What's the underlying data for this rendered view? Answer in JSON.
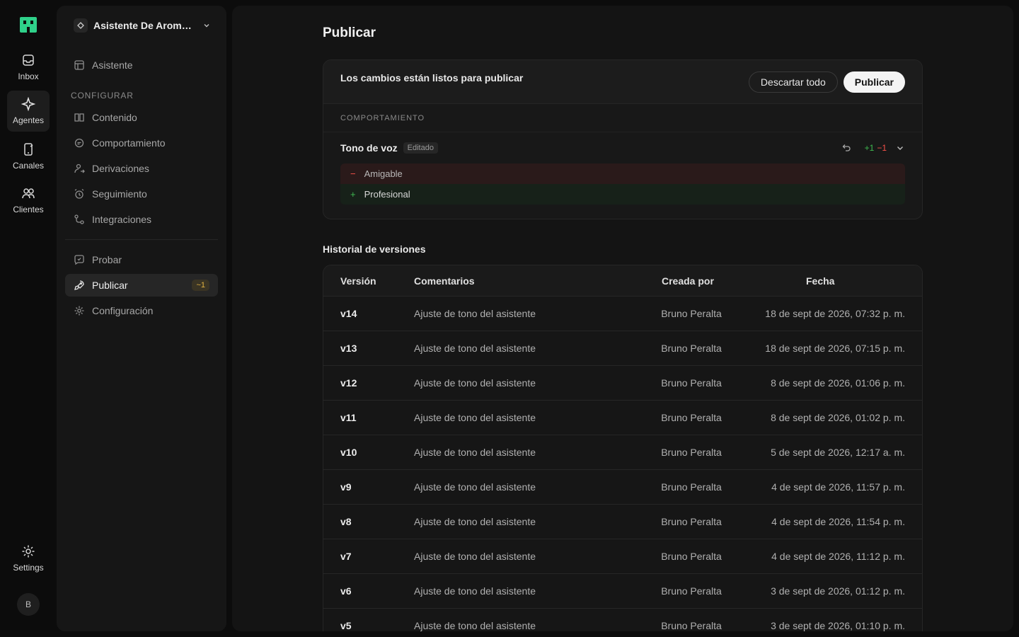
{
  "rail": {
    "items": [
      {
        "label": "Inbox",
        "icon": "inbox-icon"
      },
      {
        "label": "Agentes",
        "icon": "sparkle-icon"
      },
      {
        "label": "Canales",
        "icon": "phone-icon"
      },
      {
        "label": "Clientes",
        "icon": "users-icon"
      }
    ],
    "settings_label": "Settings",
    "avatar_initial": "B"
  },
  "panel": {
    "agent_name": "Asistente De Aromaterapia",
    "top_item": "Asistente",
    "section_label": "CONFIGURAR",
    "config_items": [
      "Contenido",
      "Comportamiento",
      "Derivaciones",
      "Seguimiento",
      "Integraciones"
    ],
    "bottom_items": [
      "Probar",
      "Publicar",
      "Configuración"
    ],
    "publish_badge": "~1"
  },
  "main": {
    "title": "Publicar",
    "changes_title": "Los cambios están listos para publicar",
    "discard_label": "Descartar todo",
    "publish_label": "Publicar",
    "category": "COMPORTAMIENTO",
    "field_name": "Tono de voz",
    "edited_badge": "Editado",
    "diff_add": "+1",
    "diff_remove": "−1",
    "removed_value": "Amigable",
    "added_value": "Profesional",
    "history_title": "Historial de versiones",
    "columns": {
      "version": "Versión",
      "comments": "Comentarios",
      "created_by": "Creada por",
      "date": "Fecha"
    },
    "versions": [
      {
        "v": "v14",
        "c": "Ajuste de tono del asistente",
        "by": "Bruno Peralta",
        "d": "18 de sept de 2026, 07:32 p. m."
      },
      {
        "v": "v13",
        "c": "Ajuste de tono del asistente",
        "by": "Bruno Peralta",
        "d": "18 de sept de 2026, 07:15 p. m."
      },
      {
        "v": "v12",
        "c": "Ajuste de tono del asistente",
        "by": "Bruno Peralta",
        "d": "8 de sept de 2026, 01:06 p. m."
      },
      {
        "v": "v11",
        "c": "Ajuste de tono del asistente",
        "by": "Bruno Peralta",
        "d": "8 de sept de 2026, 01:02 p. m."
      },
      {
        "v": "v10",
        "c": "Ajuste de tono del asistente",
        "by": "Bruno Peralta",
        "d": "5 de sept de 2026, 12:17 a. m."
      },
      {
        "v": "v9",
        "c": "Ajuste de tono del asistente",
        "by": "Bruno Peralta",
        "d": "4 de sept de 2026, 11:57 p. m."
      },
      {
        "v": "v8",
        "c": "Ajuste de tono del asistente",
        "by": "Bruno Peralta",
        "d": "4 de sept de 2026, 11:54 p. m."
      },
      {
        "v": "v7",
        "c": "Ajuste de tono del asistente",
        "by": "Bruno Peralta",
        "d": "4 de sept de 2026, 11:12 p. m."
      },
      {
        "v": "v6",
        "c": "Ajuste de tono del asistente",
        "by": "Bruno Peralta",
        "d": "3 de sept de 2026, 01:12 p. m."
      },
      {
        "v": "v5",
        "c": "Ajuste de tono del asistente",
        "by": "Bruno Peralta",
        "d": "3 de sept de 2026, 01:10 p. m."
      }
    ]
  },
  "colors": {
    "accent": "#3fb950",
    "danger": "#f85149",
    "warning": "#e3b341",
    "logo": "#2fd18a"
  }
}
